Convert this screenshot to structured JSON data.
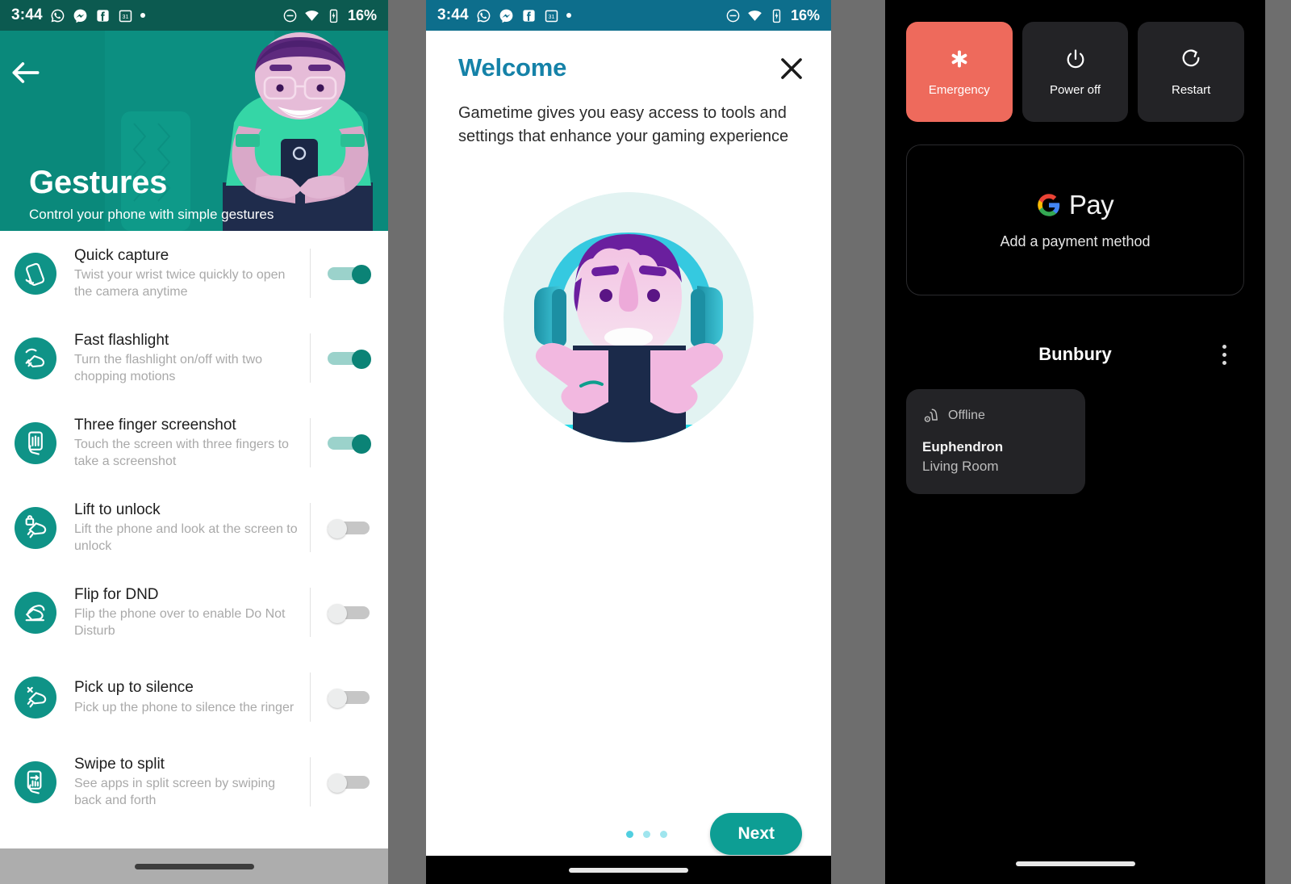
{
  "statusbar": {
    "time": "3:44",
    "left_icons": [
      "whatsapp-icon",
      "messenger-icon",
      "facebook-icon",
      "calendar-icon",
      "dot-icon"
    ],
    "right_icons": [
      "dnd-icon",
      "wifi-icon",
      "battery-charging-icon"
    ],
    "battery": "16%"
  },
  "gestures_screen": {
    "back_icon": "back-arrow-icon",
    "title": "Gestures",
    "subtitle": "Control your phone with simple gestures",
    "items": [
      {
        "icon": "twist-phone-icon",
        "name": "Quick capture",
        "desc": "Twist your wrist twice quickly to open the camera anytime",
        "toggle": "on"
      },
      {
        "icon": "chop-hand-icon",
        "name": "Fast flashlight",
        "desc": "Turn the flashlight on/off with two chopping motions",
        "toggle": "on"
      },
      {
        "icon": "three-finger-icon",
        "name": "Three finger screenshot",
        "desc": "Touch the screen with three fingers to take a screenshot",
        "toggle": "on"
      },
      {
        "icon": "lift-lock-icon",
        "name": "Lift to unlock",
        "desc": "Lift the phone and look at the screen to unlock",
        "toggle": "off"
      },
      {
        "icon": "flip-phone-icon",
        "name": "Flip for DND",
        "desc": "Flip the phone over to enable Do Not Disturb",
        "toggle": "off"
      },
      {
        "icon": "mute-hand-icon",
        "name": "Pick up to silence",
        "desc": "Pick up the phone to silence the ringer",
        "toggle": "off"
      },
      {
        "icon": "swipe-split-icon",
        "name": "Swipe to split",
        "desc": "See apps in split screen by swiping back and forth",
        "toggle": "off"
      }
    ],
    "colors": {
      "header_bg": "#0a897b",
      "statusbar_bg": "#0c5a50",
      "icon_bg": "#0f9387",
      "toggle_on": "#0b8376"
    }
  },
  "gametime_screen": {
    "title": "Welcome",
    "close_icon": "close-icon",
    "body": "Gametime gives you easy access to tools and settings that enhance your gaming experience",
    "illustration": "gamer-with-headset-illustration",
    "page_dots": 3,
    "active_dot": 1,
    "next_label": "Next",
    "colors": {
      "title": "#1582a8",
      "statusbar_bg": "#0d6e8c",
      "next_bg": "#0d9e94",
      "dot": "#51cfe0"
    }
  },
  "power_screen": {
    "tiles": [
      {
        "icon": "emergency-asterisk-icon",
        "label": "Emergency",
        "style": "emergency"
      },
      {
        "icon": "power-icon",
        "label": "Power off",
        "style": "default"
      },
      {
        "icon": "restart-icon",
        "label": "Restart",
        "style": "default"
      }
    ],
    "wallet_card": {
      "brand_icon": "google-g-icon",
      "brand_word": "Pay",
      "subtitle": "Add a payment method"
    },
    "home_controls": {
      "title": "Bunbury",
      "overflow_icon": "kebab-menu-icon",
      "device": {
        "status_icon": "vacuum-icon",
        "status": "Offline",
        "name": "Euphendron",
        "room": "Living Room"
      }
    },
    "colors": {
      "background": "#000000",
      "tile_bg": "#232326",
      "emergency_bg": "#ee6a5c"
    }
  }
}
